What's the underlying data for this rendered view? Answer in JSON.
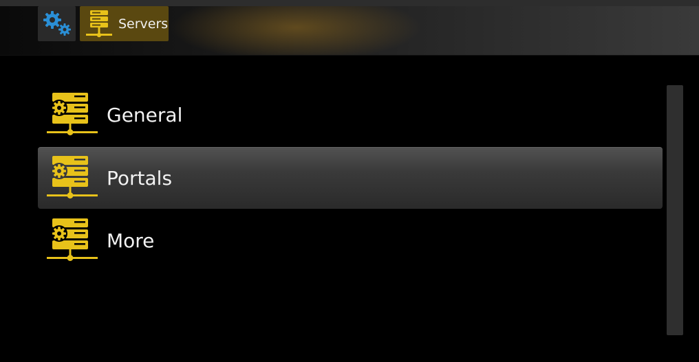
{
  "header": {
    "settings_icon": "gears-icon",
    "breadcrumb_label": "Servers",
    "breadcrumb_icon": "server-icon",
    "accent_color": "#5a4810"
  },
  "menu": {
    "items": [
      {
        "label": "General",
        "icon": "server-gear-icon",
        "selected": false
      },
      {
        "label": "Portals",
        "icon": "server-gear-icon",
        "selected": true
      },
      {
        "label": "More",
        "icon": "server-gear-icon",
        "selected": false
      }
    ],
    "icon_color": "#e8c21a",
    "selection_color": "#3a3a3a"
  }
}
